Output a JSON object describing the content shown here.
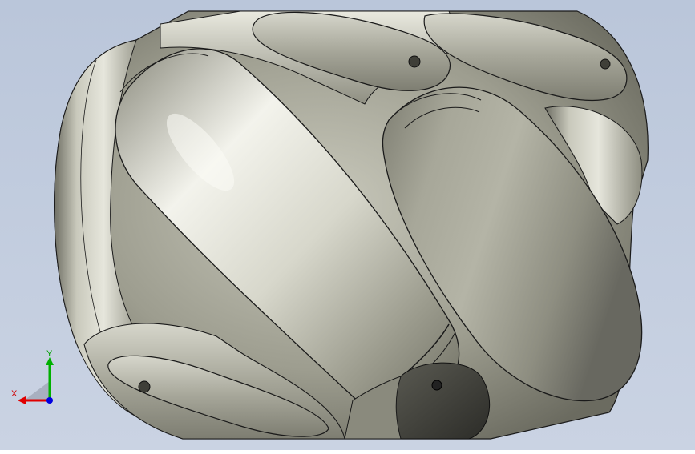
{
  "viewport": {
    "background_top": "#bcc8dc",
    "background_bottom": "#c9d2e2",
    "metal_light": "#f2f2ea",
    "metal_mid": "#a9a99a",
    "metal_dark": "#4d4d45",
    "edge_color": "#1a1a1a"
  },
  "triad": {
    "x_label": "X",
    "y_label": "Y",
    "x_color": "#e00000",
    "y_color": "#00b000",
    "z_color": "#0000e0"
  }
}
